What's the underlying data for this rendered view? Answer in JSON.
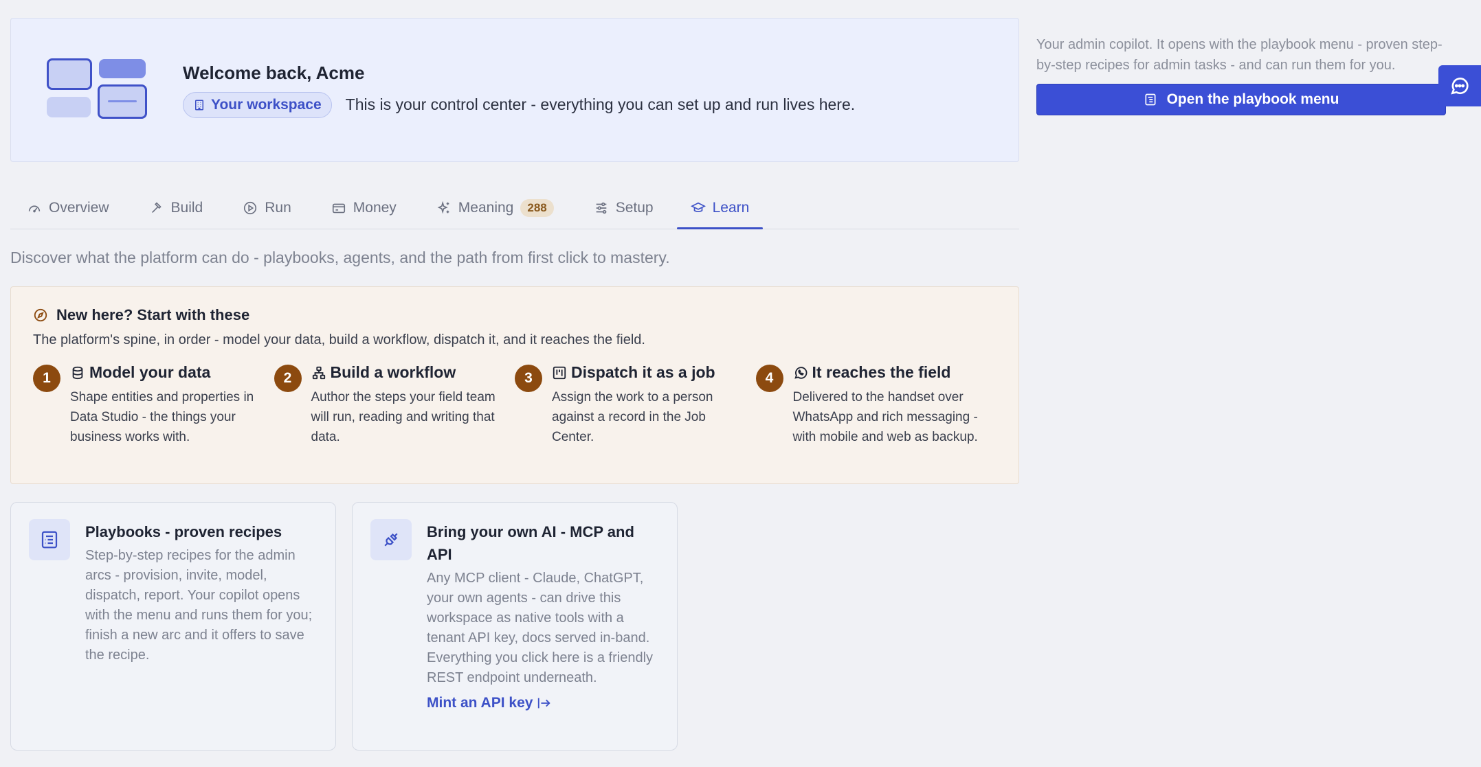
{
  "hero": {
    "title": "Welcome back, Acme",
    "workspace_chip": "Your workspace",
    "description": "This is your control center - everything you can set up and run lives here."
  },
  "tabs": [
    {
      "label": "Overview",
      "icon": "gauge-icon"
    },
    {
      "label": "Build",
      "icon": "hammer-icon"
    },
    {
      "label": "Run",
      "icon": "play-circle-icon"
    },
    {
      "label": "Money",
      "icon": "credit-card-icon"
    },
    {
      "label": "Meaning",
      "icon": "sparkles-icon",
      "badge": "288"
    },
    {
      "label": "Setup",
      "icon": "sliders-icon"
    },
    {
      "label": "Learn",
      "icon": "graduation-cap-icon",
      "active": true
    }
  ],
  "subtitle": "Discover what the platform can do - playbooks, agents, and the path from first click to mastery.",
  "start": {
    "title": "New here? Start with these",
    "description": "The platform's spine, in order - model your data, build a workflow, dispatch it, and it reaches the field.",
    "steps": [
      {
        "num": "1",
        "title": "Model your data",
        "icon": "database-icon",
        "desc": "Shape entities and properties in Data Studio - the things your business works with."
      },
      {
        "num": "2",
        "title": "Build a workflow",
        "icon": "workflow-icon",
        "desc": "Author the steps your field team will run, reading and writing that data."
      },
      {
        "num": "3",
        "title": "Dispatch it as a job",
        "icon": "kanban-icon",
        "desc": "Assign the work to a person against a record in the Job Center."
      },
      {
        "num": "4",
        "title": "It reaches the field",
        "icon": "whatsapp-icon",
        "desc": "Delivered to the handset over WhatsApp and rich messaging - with mobile and web as backup."
      }
    ]
  },
  "cards": [
    {
      "title": "Playbooks - proven recipes",
      "icon": "playbook-icon",
      "desc": "Step-by-step recipes for the admin arcs - provision, invite, model, dispatch, report. Your copilot opens with the menu and runs them for you; finish a new arc and it offers to save the recipe."
    },
    {
      "title": "Bring your own AI - MCP and API",
      "icon": "plug-icon",
      "desc": "Any MCP client - Claude, ChatGPT, your own agents - can drive this workspace as native tools with a tenant API key, docs served in-band. Everything you click here is a friendly REST endpoint underneath.",
      "link": "Mint an API key"
    }
  ],
  "copilot": {
    "text": "Your admin copilot. It opens with the playbook menu - proven step-by-step recipes for admin tasks - and can run them for you.",
    "button": "Open the playbook menu"
  },
  "colors": {
    "accent": "#3d51c7",
    "step_number": "#8c4a0f",
    "background": "#f0f1f5"
  }
}
